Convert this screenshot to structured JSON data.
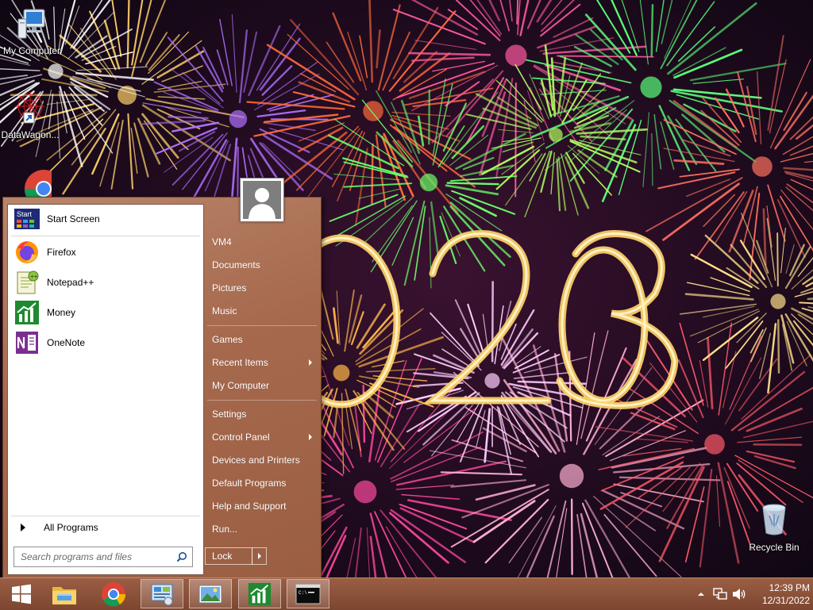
{
  "desktop": {
    "icons": [
      {
        "label": "My Computer",
        "icon": "computer-icon"
      },
      {
        "label": "DataWagon...",
        "icon": "datawagon-shortcut-icon"
      },
      {
        "label": "",
        "icon": "chrome-icon"
      },
      {
        "label": "Recycle Bin",
        "icon": "recycle-bin-icon"
      }
    ],
    "wallpaper": "fireworks-2023"
  },
  "start_menu": {
    "pinned": [
      {
        "label": "Start Screen",
        "icon": "start-screen-icon"
      },
      {
        "label": "Firefox",
        "icon": "firefox-icon"
      },
      {
        "label": "Notepad++",
        "icon": "notepad-plus-plus-icon"
      },
      {
        "label": "Money",
        "icon": "money-icon"
      },
      {
        "label": "OneNote",
        "icon": "onenote-icon"
      }
    ],
    "start_tile_text": "Start",
    "all_programs": "All Programs",
    "search_placeholder": "Search programs and files",
    "right": [
      {
        "label": "VM4"
      },
      {
        "label": "Documents"
      },
      {
        "label": "Pictures"
      },
      {
        "label": "Music"
      },
      {
        "label": "Games"
      },
      {
        "label": "Recent Items",
        "submenu": true
      },
      {
        "label": "My Computer"
      },
      {
        "label": "Settings"
      },
      {
        "label": "Control Panel",
        "submenu": true
      },
      {
        "label": "Devices and Printers"
      },
      {
        "label": "Default Programs"
      },
      {
        "label": "Help and Support"
      },
      {
        "label": "Run..."
      }
    ],
    "lock_label": "Lock"
  },
  "taskbar": {
    "buttons": [
      {
        "icon": "windows-start-icon",
        "active": false
      },
      {
        "icon": "file-explorer-icon",
        "active": false
      },
      {
        "icon": "chrome-icon",
        "active": false
      },
      {
        "icon": "control-panel-icon",
        "active": true
      },
      {
        "icon": "image-viewer-icon",
        "active": true
      },
      {
        "icon": "money-icon",
        "active": true
      },
      {
        "icon": "command-prompt-icon",
        "active": true
      }
    ],
    "tray_icons": [
      "show-hidden-icons-icon",
      "network-icon",
      "volume-icon"
    ],
    "clock": {
      "time": "12:39 PM",
      "date": "12/31/2022"
    }
  },
  "colors": {
    "menu_accent": "#a6694d",
    "taskbar": "#8a5139"
  }
}
